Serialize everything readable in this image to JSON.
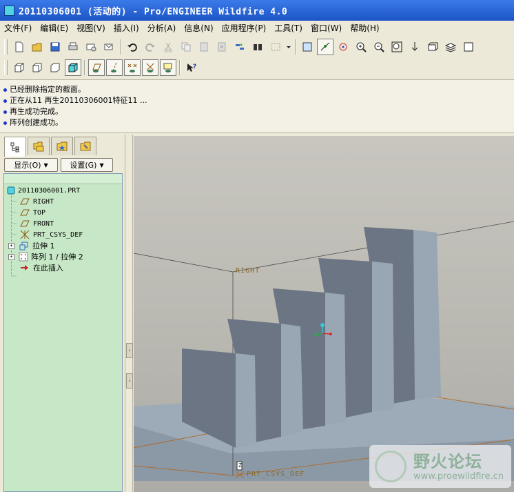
{
  "window": {
    "title": "20110306001 (活动的) - Pro/ENGINEER Wildfire 4.0"
  },
  "menubar": [
    "文件(F)",
    "编辑(E)",
    "视图(V)",
    "插入(I)",
    "分析(A)",
    "信息(N)",
    "应用程序(P)",
    "工具(T)",
    "窗口(W)",
    "帮助(H)"
  ],
  "toolbar1": [
    "new-file",
    "open-folder",
    "save",
    "print",
    "send-mail",
    "mail-attach",
    "undo",
    "redo",
    "cut",
    "copy",
    "paste",
    "paste-special",
    "regenerate",
    "find",
    "select-box",
    "view-orient",
    "datum-display",
    "spin-center",
    "zoom-in",
    "zoom-out",
    "refit",
    "reorient",
    "named-view",
    "layers",
    "window"
  ],
  "toolbar2": [
    "shading",
    "hidden-line",
    "no-hidden",
    "wireframe",
    "datum-planes",
    "datum-axes",
    "datum-points",
    "csys",
    "annotation",
    "whats-this"
  ],
  "messages": [
    "已经删除指定的截面。",
    "正在从11 再生20110306001特征11 ...",
    "再生成功完成。",
    "阵列创建成功。"
  ],
  "navigator": {
    "tabs": [
      "model-tree",
      "folder-browser",
      "favorites",
      "connections"
    ],
    "show_button": "显示(O)",
    "settings_button": "设置(G)"
  },
  "tree": [
    {
      "label": "20110306001.PRT",
      "icon": "part-icon"
    },
    {
      "label": "RIGHT",
      "icon": "datum-plane-icon"
    },
    {
      "label": "TOP",
      "icon": "datum-plane-icon"
    },
    {
      "label": "FRONT",
      "icon": "datum-plane-icon"
    },
    {
      "label": "PRT_CSYS_DEF",
      "icon": "csys-icon"
    },
    {
      "label": "拉伸 1",
      "icon": "extrude-icon"
    },
    {
      "label": "阵列 1 / 拉伸 2",
      "icon": "pattern-icon"
    },
    {
      "label": "在此插入",
      "icon": "insert-here-icon"
    }
  ],
  "viewport": {
    "labels": {
      "right": "RIGHT",
      "csys": "PRT_CSYS_DEF",
      "csys_tag": "Z"
    },
    "watermark": {
      "cn": "野火论坛",
      "en": "www.proewildfire.cn"
    }
  },
  "colors": {
    "title_bar": "#245edb",
    "tree_bg": "#c7e8c7",
    "model_front": "#6e7886",
    "model_side": "#98a7b3",
    "datum": "#b07030"
  }
}
